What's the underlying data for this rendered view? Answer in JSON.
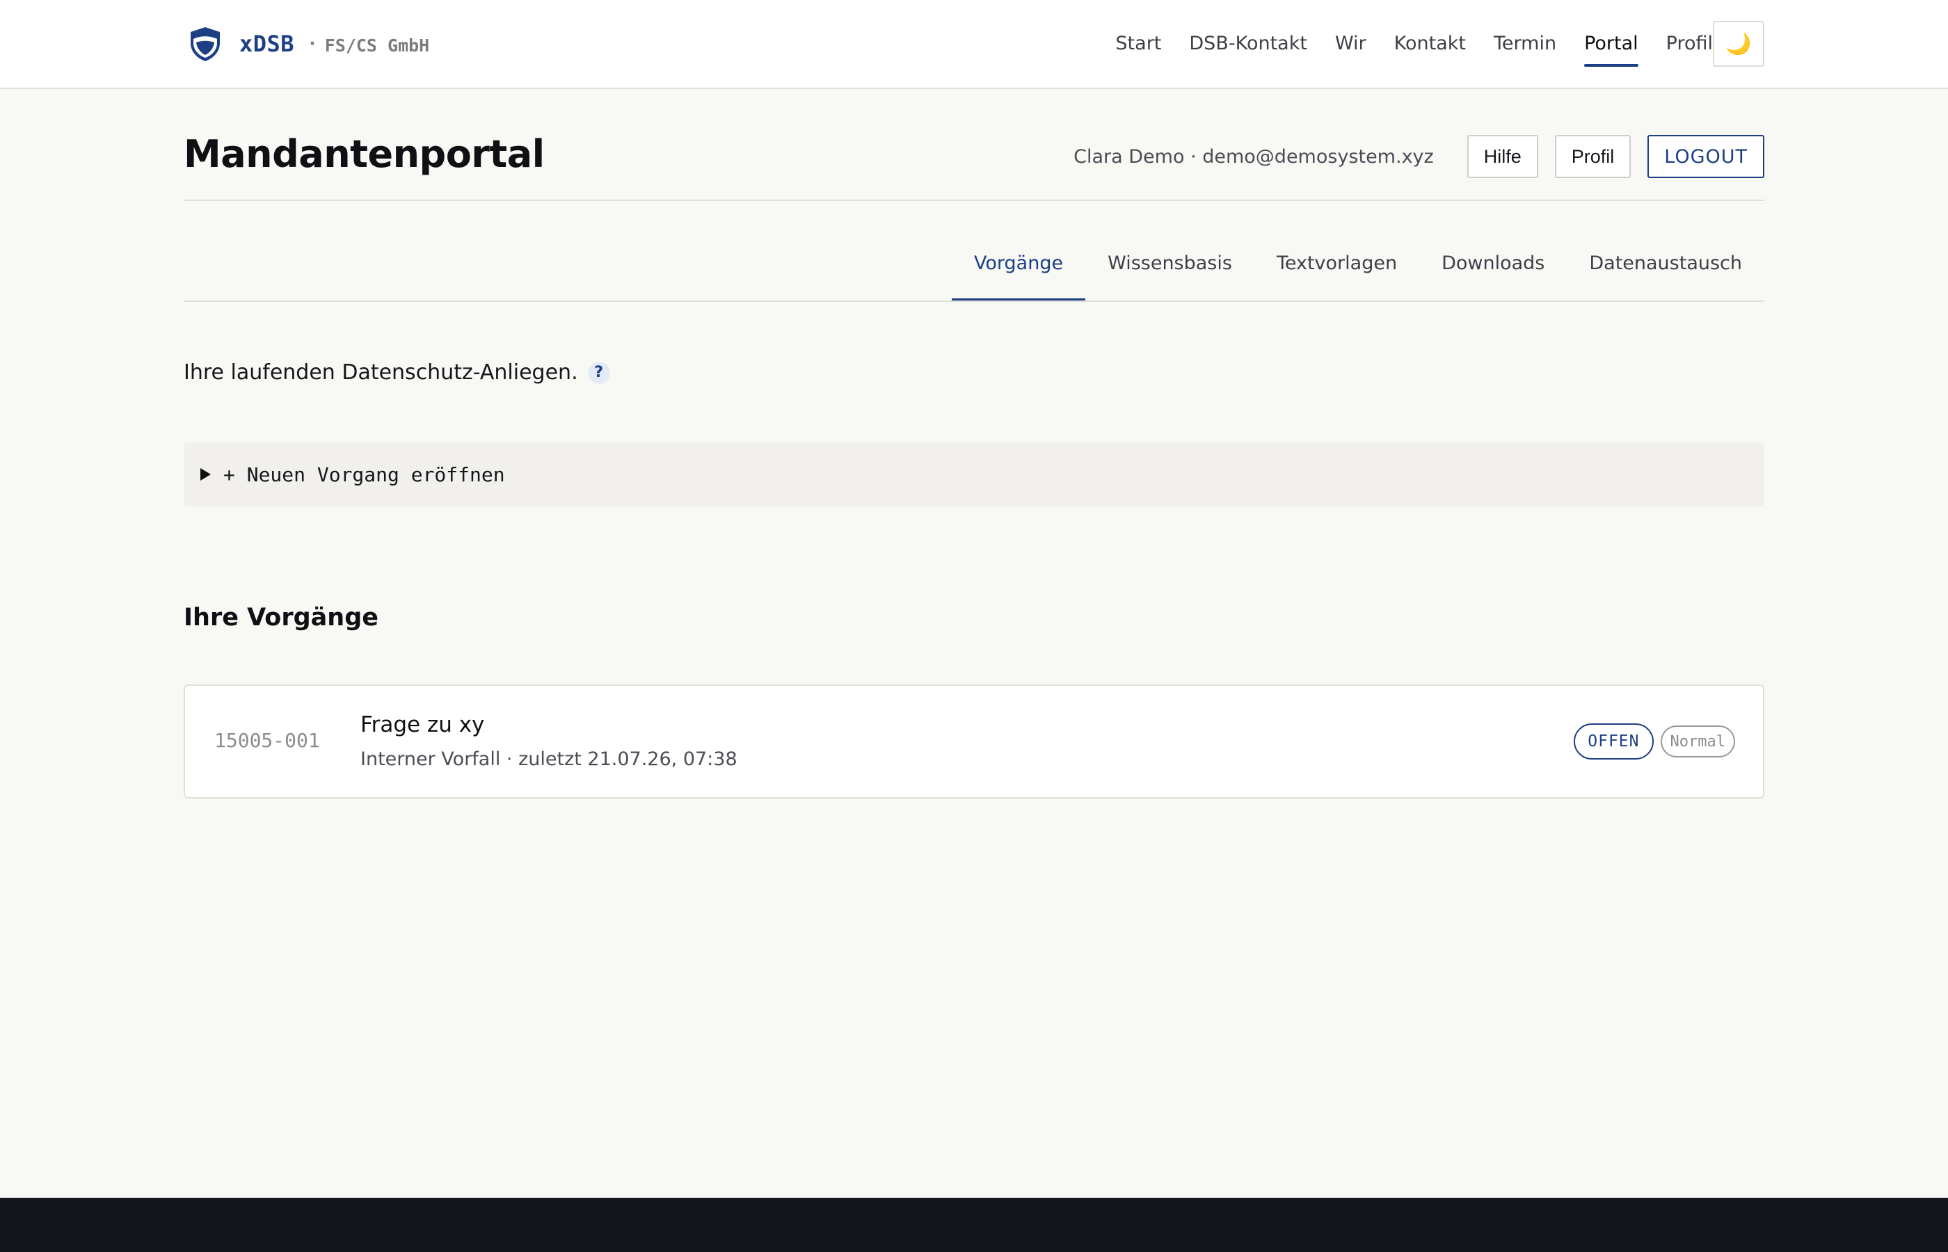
{
  "brand": {
    "name": "xDSB",
    "separator": "·",
    "company": "FS/CS GmbH",
    "logo_icon": "shield-icon"
  },
  "nav": {
    "items": [
      {
        "label": "Start",
        "active": false
      },
      {
        "label": "DSB-Kontakt",
        "active": false
      },
      {
        "label": "Wir",
        "active": false
      },
      {
        "label": "Kontakt",
        "active": false
      },
      {
        "label": "Termin",
        "active": false
      },
      {
        "label": "Portal",
        "active": true
      },
      {
        "label": "Profil",
        "active": false
      }
    ],
    "theme_toggle_icon": "moon-icon",
    "theme_toggle_glyph": "🌙"
  },
  "page": {
    "title": "Mandantenportal"
  },
  "user": {
    "info": "Clara Demo · demo@demosystem.xyz",
    "help_label": "Hilfe",
    "profile_label": "Profil",
    "logout_label": "LOGOUT"
  },
  "tabs": [
    {
      "label": "Vorgänge",
      "active": true
    },
    {
      "label": "Wissensbasis",
      "active": false
    },
    {
      "label": "Textvorlagen",
      "active": false
    },
    {
      "label": "Downloads",
      "active": false
    },
    {
      "label": "Datenaustausch",
      "active": false
    }
  ],
  "intro": {
    "text": "Ihre laufenden Datenschutz-Anliegen.",
    "help_glyph": "?"
  },
  "new_case": {
    "label": "+ Neuen Vorgang eröffnen"
  },
  "cases_section": {
    "title": "Ihre Vorgänge",
    "items": [
      {
        "id": "15005-001",
        "title": "Frage zu xy",
        "meta": "Interner Vorfall · zuletzt 21.07.26, 07:38",
        "status": "OFFEN",
        "priority": "Normal"
      }
    ]
  },
  "colors": {
    "accent": "#1c3f86",
    "background": "#f8f8f4",
    "footer": "#14161c"
  }
}
